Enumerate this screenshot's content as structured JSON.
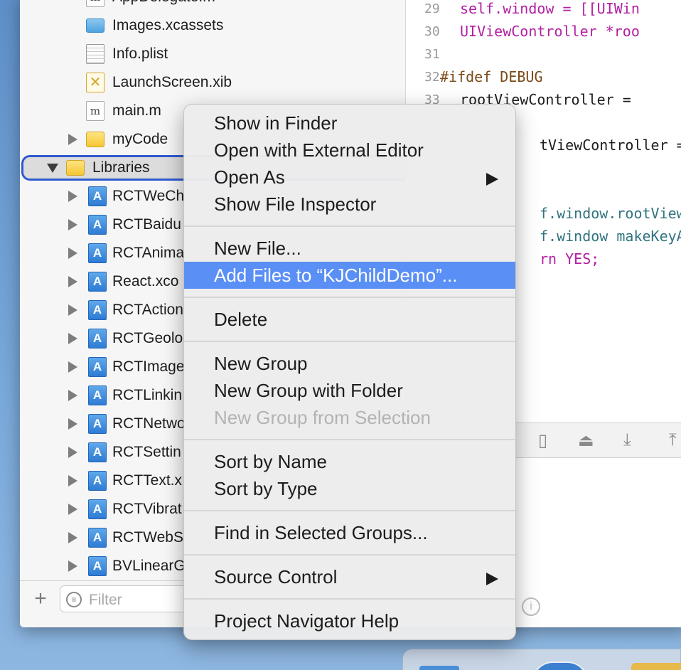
{
  "navigator": {
    "items": [
      {
        "label": "AppDelegate.m",
        "icon": "m-file-icon",
        "type": "file"
      },
      {
        "label": "Images.xcassets",
        "icon": "asset-catalog-icon",
        "type": "assets"
      },
      {
        "label": "Info.plist",
        "icon": "plist-file-icon",
        "type": "plist"
      },
      {
        "label": "LaunchScreen.xib",
        "icon": "xib-file-icon",
        "type": "xib"
      },
      {
        "label": "main.m",
        "icon": "m-file-icon",
        "type": "file"
      },
      {
        "label": "myCode",
        "icon": "folder-icon",
        "type": "folder"
      },
      {
        "label": "Libraries",
        "icon": "folder-icon",
        "type": "folder-open"
      },
      {
        "label": "RCTWeCh",
        "icon": "xcodeproj-icon",
        "type": "proj"
      },
      {
        "label": "RCTBaidu",
        "icon": "xcodeproj-icon",
        "type": "proj"
      },
      {
        "label": "RCTAnima",
        "icon": "xcodeproj-icon",
        "type": "proj"
      },
      {
        "label": "React.xco",
        "icon": "xcodeproj-icon",
        "type": "proj"
      },
      {
        "label": "RCTAction",
        "icon": "xcodeproj-icon",
        "type": "proj"
      },
      {
        "label": "RCTGeolo",
        "icon": "xcodeproj-icon",
        "type": "proj"
      },
      {
        "label": "RCTImage",
        "icon": "xcodeproj-icon",
        "type": "proj"
      },
      {
        "label": "RCTLinkin",
        "icon": "xcodeproj-icon",
        "type": "proj"
      },
      {
        "label": "RCTNetwo",
        "icon": "xcodeproj-icon",
        "type": "proj"
      },
      {
        "label": "RCTSettin",
        "icon": "xcodeproj-icon",
        "type": "proj"
      },
      {
        "label": "RCTText.x",
        "icon": "xcodeproj-icon",
        "type": "proj"
      },
      {
        "label": "RCTVibrat",
        "icon": "xcodeproj-icon",
        "type": "proj"
      },
      {
        "label": "RCTWebS",
        "icon": "xcodeproj-icon",
        "type": "proj"
      },
      {
        "label": "BVLinearG",
        "icon": "xcodeproj-icon",
        "type": "proj"
      }
    ],
    "filter_placeholder": "Filter",
    "add_button": "+"
  },
  "editor": {
    "lines": [
      {
        "num": "29",
        "text": "self.window = [[UIWin"
      },
      {
        "num": "30",
        "text": "UIViewController *roo"
      },
      {
        "num": "31",
        "text": ""
      },
      {
        "num": "32",
        "text": "#ifdef DEBUG"
      },
      {
        "num": "33",
        "text": "rootViewController ="
      },
      {
        "num": "",
        "text": "tViewController ="
      },
      {
        "num": "",
        "text": "f.window.rootViewC"
      },
      {
        "num": "",
        "text": "f.window makeKeyA"
      },
      {
        "num": "",
        "text": "rn YES;"
      }
    ]
  },
  "context_menu": {
    "items": [
      {
        "label": "Show in Finder",
        "state": "normal"
      },
      {
        "label": "Open with External Editor",
        "state": "normal"
      },
      {
        "label": "Open As",
        "state": "submenu"
      },
      {
        "label": "Show File Inspector",
        "state": "normal"
      },
      {
        "label": "New File...",
        "state": "normal"
      },
      {
        "label": "Add Files to “KJChildDemo”...",
        "state": "highlighted"
      },
      {
        "label": "Delete",
        "state": "normal"
      },
      {
        "label": "New Group",
        "state": "normal"
      },
      {
        "label": "New Group with Folder",
        "state": "normal"
      },
      {
        "label": "New Group from Selection",
        "state": "disabled"
      },
      {
        "label": "Sort by Name",
        "state": "normal"
      },
      {
        "label": "Sort by Type",
        "state": "normal"
      },
      {
        "label": "Find in Selected Groups...",
        "state": "normal"
      },
      {
        "label": "Source Control",
        "state": "submenu"
      },
      {
        "label": "Project Navigator Help",
        "state": "normal"
      }
    ]
  },
  "colors": {
    "highlight": "#5a8ff5",
    "selection_outline": "#2f5bd0",
    "keyword_purple": "#b31fa1",
    "preprocessor_brown": "#7a4b19",
    "identifier_teal": "#317480"
  }
}
